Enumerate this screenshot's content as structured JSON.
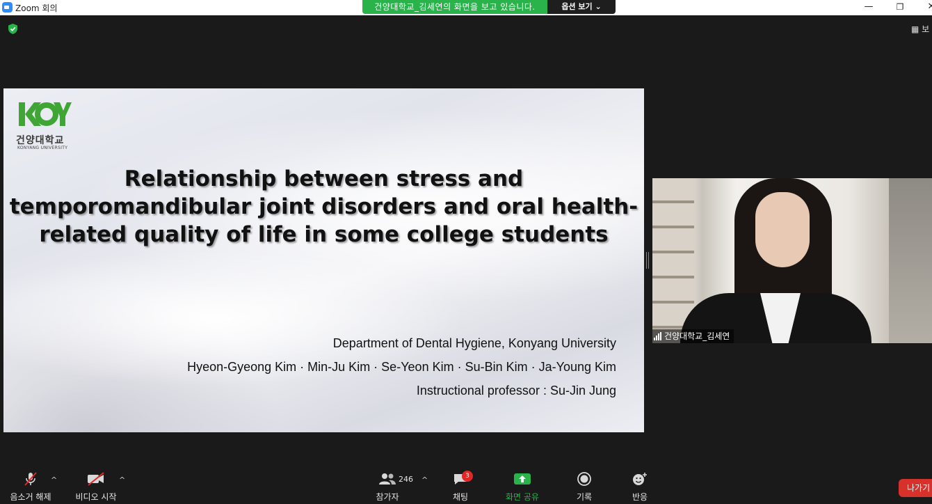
{
  "window": {
    "title": "Zoom 회의",
    "minimize_glyph": "—",
    "restore_glyph": "❐",
    "close_glyph": "✕"
  },
  "share_banner": {
    "text": "건양대학교_김세연의 화면을 보고 있습니다.",
    "view_options_label": "옵션 보기 ⌄"
  },
  "top_right": {
    "view_label": "보"
  },
  "slide": {
    "logo_korean": "건양대학교",
    "logo_english": "KONYANG UNIVERSITY",
    "title": "Relationship between stress and temporomandibular joint disorders and oral health-related quality of life in some college students",
    "department": "Department of Dental Hygiene, Konyang University",
    "authors": "Hyeon-Gyeong Kim · Min-Ju Kim · Se-Yeon Kim · Su-Bin Kim · Ja-Young Kim",
    "professor": "Instructional professor : Su-Jin Jung"
  },
  "video": {
    "participant_name": "건양대학교_김세연"
  },
  "toolbar": {
    "unmute_label": "음소거 해제",
    "start_video_label": "비디오 시작",
    "participants_label": "참가자",
    "participants_count": "246",
    "chat_label": "채팅",
    "chat_badge": "3",
    "share_screen_label": "화면 공유",
    "record_label": "기록",
    "reactions_label": "반응",
    "leave_label": "나가기"
  },
  "colors": {
    "share_green": "#2bb34b",
    "leave_red": "#d6312b",
    "logo_green": "#3fa535"
  }
}
